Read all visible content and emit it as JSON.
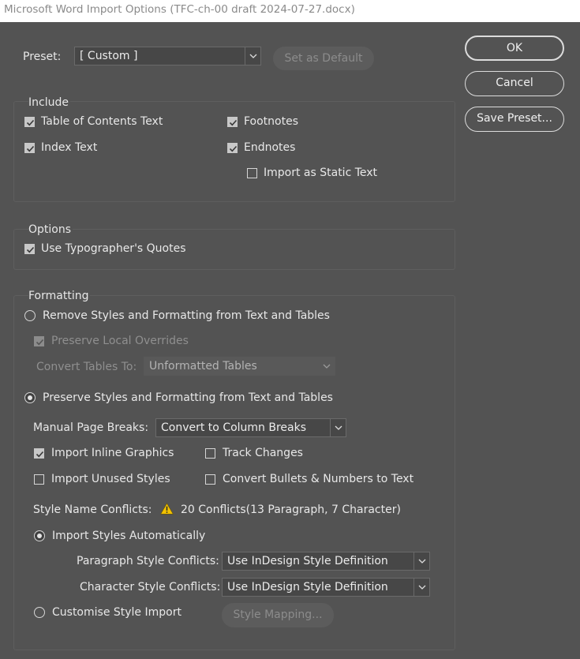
{
  "window": {
    "title": "Microsoft Word Import Options (TFC-ch-00 draft 2024-07-27.docx)"
  },
  "preset": {
    "label": "Preset:",
    "value": "[ Custom ]",
    "set_default_label": "Set as Default"
  },
  "buttons": {
    "ok": "OK",
    "cancel": "Cancel",
    "save_preset": "Save Preset..."
  },
  "include": {
    "title": "Include",
    "toc": {
      "label": "Table of Contents Text",
      "checked": true
    },
    "index": {
      "label": "Index Text",
      "checked": true
    },
    "footnotes": {
      "label": "Footnotes",
      "checked": true
    },
    "endnotes": {
      "label": "Endnotes",
      "checked": true
    },
    "static": {
      "label": "Import as Static Text",
      "checked": false
    }
  },
  "options": {
    "title": "Options",
    "quotes": {
      "label": "Use Typographer's Quotes",
      "checked": true
    }
  },
  "formatting": {
    "title": "Formatting",
    "remove_styles": {
      "label": "Remove Styles and Formatting from Text and Tables",
      "selected": false
    },
    "preserve_overrides": {
      "label": "Preserve Local Overrides",
      "checked": true
    },
    "convert_tables": {
      "label": "Convert Tables To:",
      "value": "Unformatted Tables"
    },
    "preserve_styles": {
      "label": "Preserve Styles and Formatting from Text and Tables",
      "selected": true
    },
    "page_breaks": {
      "label": "Manual Page Breaks:",
      "value": "Convert to Column Breaks"
    },
    "inline_graphics": {
      "label": "Import Inline Graphics",
      "checked": true
    },
    "track_changes": {
      "label": "Track Changes",
      "checked": false
    },
    "unused_styles": {
      "label": "Import Unused Styles",
      "checked": false
    },
    "convert_bullets": {
      "label": "Convert Bullets & Numbers to Text",
      "checked": false
    },
    "conflicts": {
      "label": "Style Name Conflicts:",
      "value": "20 Conflicts(13 Paragraph, 7 Character)",
      "icon": "warning-icon"
    },
    "auto_import": {
      "label": "Import Styles Automatically",
      "selected": true
    },
    "para_conflicts": {
      "label": "Paragraph Style Conflicts:",
      "value": "Use InDesign Style Definition"
    },
    "char_conflicts": {
      "label": "Character Style Conflicts:",
      "value": "Use InDesign Style Definition"
    },
    "customise": {
      "label": "Customise Style Import",
      "selected": false
    },
    "style_mapping": "Style Mapping..."
  },
  "colors": {
    "background": "#535353",
    "warning": "#f2c200"
  }
}
